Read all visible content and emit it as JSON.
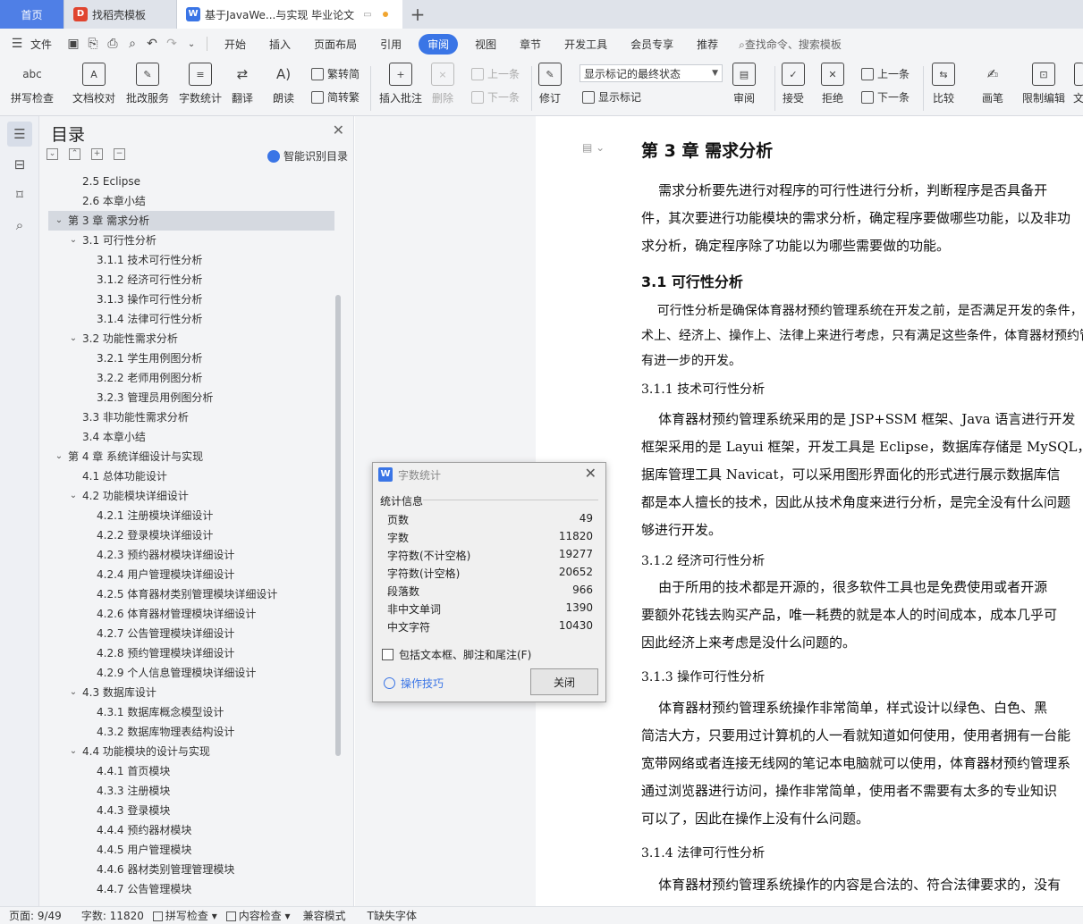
{
  "tabs": {
    "home": "首页",
    "template": "找稻壳模板",
    "doc": "基于JavaWe...与实现 毕业论文"
  },
  "menu": {
    "file": "文件",
    "items": [
      "开始",
      "插入",
      "页面布局",
      "引用",
      "审阅",
      "视图",
      "章节",
      "开发工具",
      "会员专享",
      "推荐"
    ],
    "active": "审阅",
    "search": "查找命令、搜索模板"
  },
  "ribbon": {
    "spell": "拼写检查",
    "proof": "文档校对",
    "batch": "批改服务",
    "wordcount": "字数统计",
    "translate": "翻译",
    "read": "朗读",
    "trad": "繁转简",
    "simp": "简转繁",
    "insert_comment": "插入批注",
    "delete": "删除",
    "prev": "上一条",
    "next": "下一条",
    "track": "修订",
    "markup_select": "显示标记的最终状态",
    "show_markup": "显示标记",
    "review": "审阅",
    "accept": "接受",
    "reject": "拒绝",
    "prev2": "上一条",
    "next2": "下一条",
    "compare": "比较",
    "pen": "画笔",
    "restrict": "限制编辑",
    "extra": "文"
  },
  "toc": {
    "title": "目录",
    "smart": "智能识别目录",
    "items": [
      {
        "text": "2.5 Eclipse",
        "level": 2,
        "caret": ""
      },
      {
        "text": "2.6  本章小结",
        "level": 2,
        "caret": ""
      },
      {
        "text": "第 3 章  需求分析",
        "level": 1,
        "caret": "down",
        "selected": true
      },
      {
        "text": "3.1  可行性分析",
        "level": 2,
        "caret": "down"
      },
      {
        "text": "3.1.1    技术可行性分析",
        "level": 3,
        "caret": ""
      },
      {
        "text": "3.1.2  经济可行性分析",
        "level": 3,
        "caret": ""
      },
      {
        "text": "3.1.3  操作可行性分析",
        "level": 3,
        "caret": ""
      },
      {
        "text": "3.1.4  法律可行性分析",
        "level": 3,
        "caret": ""
      },
      {
        "text": "3.2  功能性需求分析",
        "level": 2,
        "caret": "down"
      },
      {
        "text": "3.2.1  学生用例图分析",
        "level": 3,
        "caret": ""
      },
      {
        "text": "3.2.2  老师用例图分析",
        "level": 3,
        "caret": ""
      },
      {
        "text": "3.2.3  管理员用例图分析",
        "level": 3,
        "caret": ""
      },
      {
        "text": "3.3  非功能性需求分析",
        "level": 2,
        "caret": ""
      },
      {
        "text": "3.4  本章小结",
        "level": 2,
        "caret": ""
      },
      {
        "text": "第 4 章  系统详细设计与实现",
        "level": 1,
        "caret": "down"
      },
      {
        "text": "4.1  总体功能设计",
        "level": 2,
        "caret": ""
      },
      {
        "text": "4.2 功能模块详细设计",
        "level": 2,
        "caret": "down"
      },
      {
        "text": "4.2.1 注册模块详细设计",
        "level": 3,
        "caret": ""
      },
      {
        "text": "4.2.2 登录模块详细设计",
        "level": 3,
        "caret": ""
      },
      {
        "text": "4.2.3 预约器材模块详细设计",
        "level": 3,
        "caret": ""
      },
      {
        "text": "4.2.4 用户管理模块详细设计",
        "level": 3,
        "caret": ""
      },
      {
        "text": "4.2.5 体育器材类别管理模块详细设计",
        "level": 3,
        "caret": ""
      },
      {
        "text": "4.2.6 体育器材管理模块详细设计",
        "level": 3,
        "caret": ""
      },
      {
        "text": "4.2.7 公告管理模块详细设计",
        "level": 3,
        "caret": ""
      },
      {
        "text": "4.2.8 预约管理模块详细设计",
        "level": 3,
        "caret": ""
      },
      {
        "text": "4.2.9 个人信息管理模块详细设计",
        "level": 3,
        "caret": ""
      },
      {
        "text": "4.3 数据库设计",
        "level": 2,
        "caret": "down"
      },
      {
        "text": "4.3.1 数据库概念模型设计",
        "level": 3,
        "caret": ""
      },
      {
        "text": "4.3.2 数据库物理表结构设计",
        "level": 3,
        "caret": ""
      },
      {
        "text": "4.4  功能模块的设计与实现",
        "level": 2,
        "caret": "down"
      },
      {
        "text": "4.4.1  首页模块",
        "level": 3,
        "caret": ""
      },
      {
        "text": "4.3.3 注册模块",
        "level": 3,
        "caret": ""
      },
      {
        "text": "4.4.3 登录模块",
        "level": 3,
        "caret": ""
      },
      {
        "text": "4.4.4 预约器材模块",
        "level": 3,
        "caret": ""
      },
      {
        "text": "4.4.5 用户管理模块",
        "level": 3,
        "caret": ""
      },
      {
        "text": "4.4.6 器材类别管理管理模块",
        "level": 3,
        "caret": ""
      },
      {
        "text": "4.4.7 公告管理模块",
        "level": 3,
        "caret": ""
      }
    ]
  },
  "document": {
    "chapter_title": "第 3 章  需求分析",
    "p1": [
      "    需求分析要先进行对程序的可行性进行分析，判断程序是否具备开",
      "件，其次要进行功能模块的需求分析，确定程序要做哪些功能，以及非功",
      "求分析，确定程序除了功能以为哪些需要做的功能。"
    ],
    "h_31": "3.1  可行性分析",
    "p2": [
      "    可行性分析是确保体育器材预约管理系统在开发之前，是否满足开发的条件，",
      "术上、经济上、操作上、法律上来进行考虑，只有满足这些条件，体育器材预约管",
      "有进一步的开发。"
    ],
    "h_311": "3.1.1    技术可行性分析",
    "p3": [
      "    体育器材预约管理系统采用的是 JSP+SSM 框架、Java 语言进行开发",
      "框架采用的是 Layui 框架，开发工具是 Eclipse，数据库存储是 MySQL，",
      "据库管理工具 Navicat，可以采用图形界面化的形式进行展示数据库信",
      "都是本人擅长的技术，因此从技术角度来进行分析，是完全没有什么问题",
      "够进行开发。"
    ],
    "h_312": "3.1.2  经济可行性分析",
    "p4": [
      "    由于所用的技术都是开源的，很多软件工具也是免费使用或者开源",
      "要额外花钱去购买产品，唯一耗费的就是本人的时间成本，成本几乎可",
      "因此经济上来考虑是没什么问题的。"
    ],
    "h_313": "3.1.3  操作可行性分析",
    "p5": [
      "    体育器材预约管理系统操作非常简单，样式设计以绿色、白色、黑",
      "简洁大方，只要用过计算机的人一看就知道如何使用，使用者拥有一台能",
      "宽带网络或者连接无线网的笔记本电脑就可以使用，体育器材预约管理系",
      "通过浏览器进行访问，操作非常简单，使用者不需要有太多的专业知识",
      "可以了，因此在操作上没有什么问题。"
    ],
    "h_314": "3.1.4  法律可行性分析",
    "p6": [
      "    体育器材预约管理系统操作的内容是合法的、符合法律要求的，没有"
    ]
  },
  "dialog": {
    "title": "字数统计",
    "section": "统计信息",
    "rows": [
      {
        "label": "页数",
        "value": "49"
      },
      {
        "label": "字数",
        "value": "11820"
      },
      {
        "label": "字符数(不计空格)",
        "value": "19277"
      },
      {
        "label": "字符数(计空格)",
        "value": "20652"
      },
      {
        "label": "段落数",
        "value": "966"
      },
      {
        "label": "非中文单词",
        "value": "1390"
      },
      {
        "label": "中文字符",
        "value": "10430"
      }
    ],
    "checkbox": "包括文本框、脚注和尾注(F)",
    "tips": "操作技巧",
    "close": "关闭"
  },
  "status": {
    "page": "页面: 9/49",
    "words": "字数: 11820",
    "spell": "拼写检查",
    "content": "内容检查",
    "compat": "兼容模式",
    "missing_font": "缺失字体"
  }
}
